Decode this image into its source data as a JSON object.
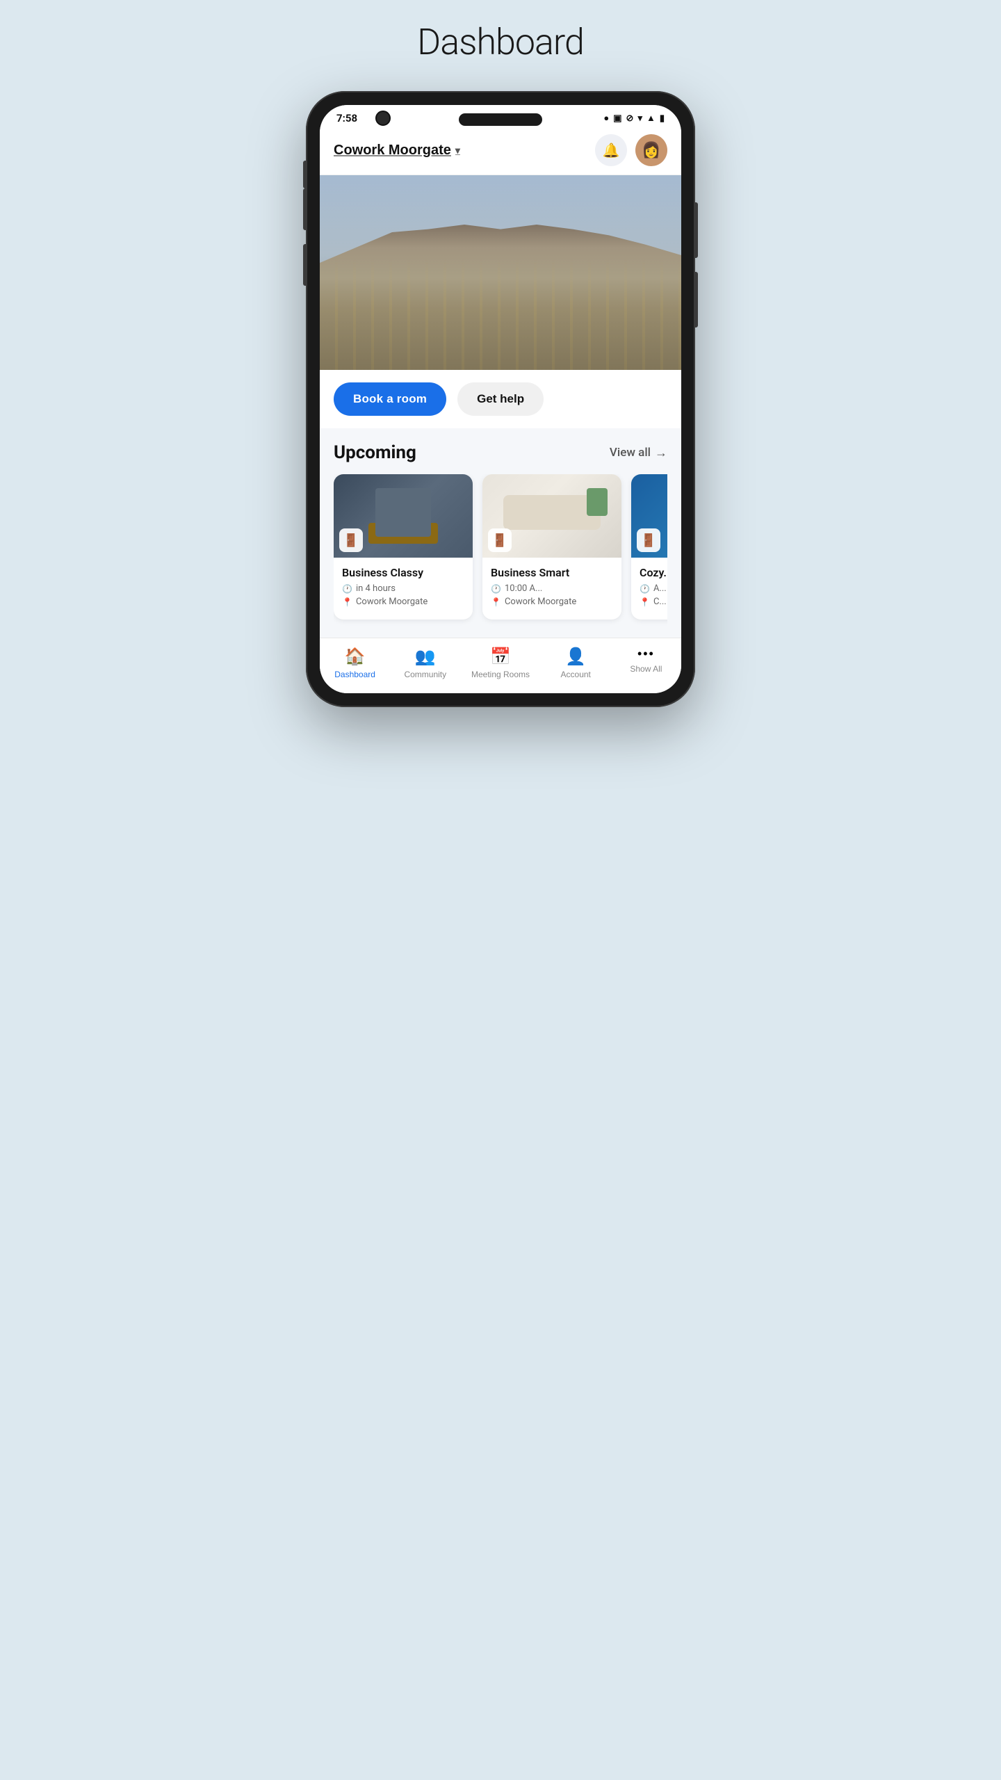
{
  "page": {
    "title": "Dashboard"
  },
  "status_bar": {
    "time": "7:58",
    "wifi_icon": "📶",
    "signal_icon": "▲",
    "battery_icon": "🔋"
  },
  "header": {
    "location": "Cowork Moorgate",
    "chevron": "▾",
    "bell_label": "🔔",
    "avatar_emoji": "👩"
  },
  "hero": {
    "alt": "Cowork Moorgate building exterior"
  },
  "actions": {
    "book_label": "Book a room",
    "help_label": "Get help"
  },
  "upcoming": {
    "title": "Upcoming",
    "view_all": "View all",
    "arrow": "→"
  },
  "cards": [
    {
      "name": "Business Classy",
      "time": "in 4 hours",
      "location": "Cowork Moorgate",
      "img_class": "card-img-1"
    },
    {
      "name": "Business Smart",
      "time": "10:00 A...",
      "location": "Cowork Moorgate",
      "img_class": "card-img-2"
    },
    {
      "name": "Cozy...",
      "time": "A...",
      "location": "C...",
      "img_class": "card-img-3"
    }
  ],
  "bottom_nav": [
    {
      "id": "dashboard",
      "icon": "🏠",
      "label": "Dashboard",
      "active": true
    },
    {
      "id": "community",
      "icon": "👥",
      "label": "Community",
      "active": false
    },
    {
      "id": "meeting-rooms",
      "icon": "📅",
      "label": "Meeting Rooms",
      "active": false
    },
    {
      "id": "account",
      "icon": "👤",
      "label": "Account",
      "active": false
    },
    {
      "id": "show-all",
      "icon": "•••",
      "label": "Show All",
      "active": false
    }
  ],
  "icons": {
    "room_icon": "🚪",
    "clock_icon": "🕐",
    "location_icon": "📍",
    "bell_icon": "🔔"
  }
}
